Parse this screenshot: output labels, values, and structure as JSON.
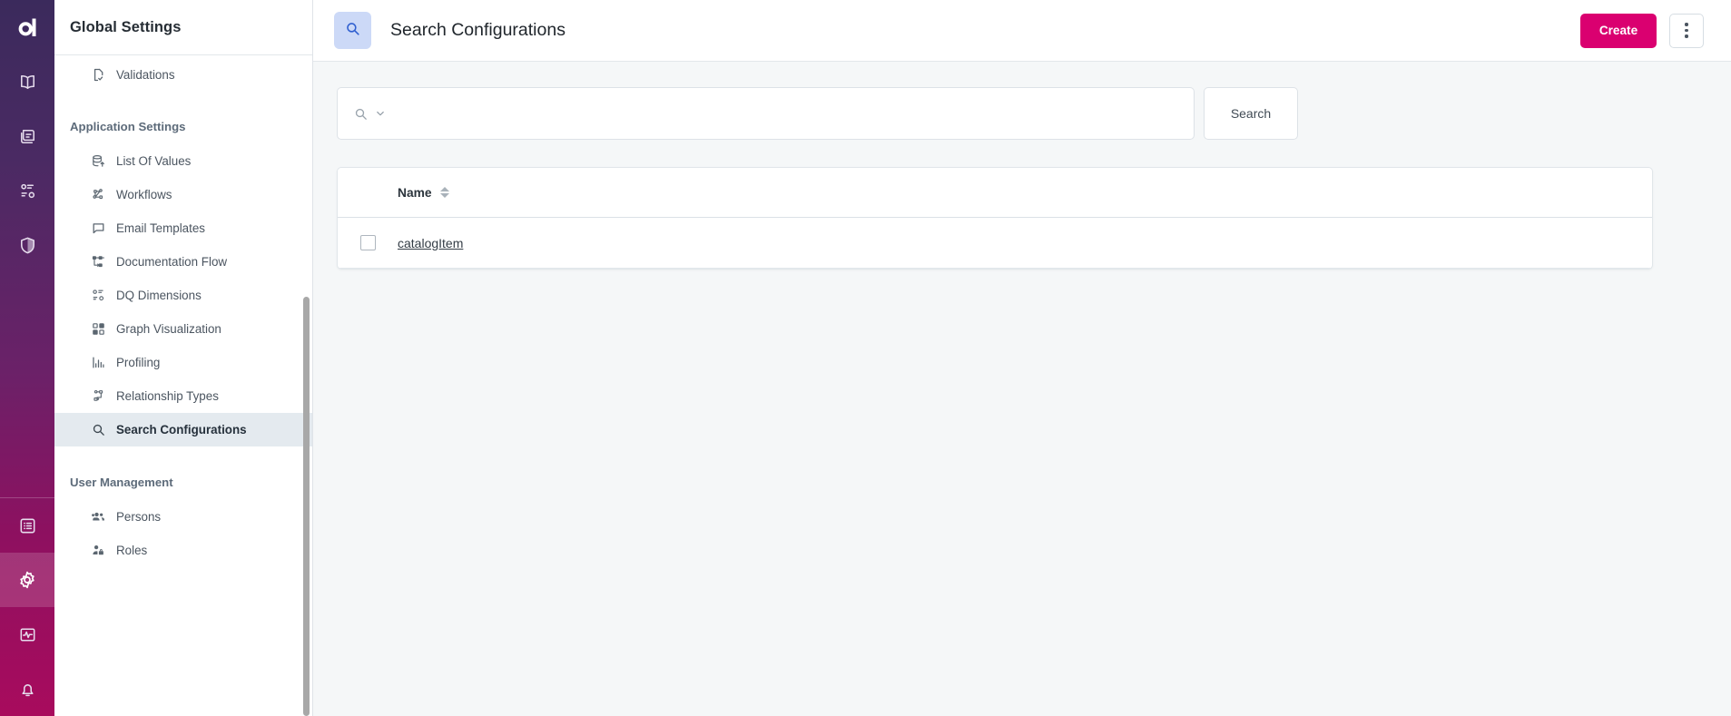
{
  "rail": {
    "logo_alt": "aplication-logo",
    "items": [
      {
        "name": "book-icon",
        "label": "Glossary",
        "active": false
      },
      {
        "name": "catalog-icon",
        "label": "Catalog",
        "active": false
      },
      {
        "name": "data-quality-icon",
        "label": "Data Quality",
        "active": false
      },
      {
        "name": "shield-icon",
        "label": "Governance",
        "active": false
      },
      {
        "name": "list-icon",
        "label": "Tasks",
        "active": false
      },
      {
        "name": "gear-icon",
        "label": "Settings",
        "active": true
      },
      {
        "name": "monitoring-icon",
        "label": "Monitoring",
        "active": false
      },
      {
        "name": "bell-icon",
        "label": "Notifications",
        "active": false
      }
    ]
  },
  "navpanel": {
    "title": "Global Settings",
    "partial_top_item": {
      "label": "Validations",
      "icon": "document-check-icon"
    },
    "groups": [
      {
        "label": "Application Settings",
        "items": [
          {
            "label": "List Of Values",
            "icon": "database-up-icon",
            "selected": false
          },
          {
            "label": "Workflows",
            "icon": "workflow-icon",
            "selected": false
          },
          {
            "label": "Email Templates",
            "icon": "speech-bubble-icon",
            "selected": false
          },
          {
            "label": "Documentation Flow",
            "icon": "flow-diagram-icon",
            "selected": false
          },
          {
            "label": "DQ Dimensions",
            "icon": "dq-dimensions-icon",
            "selected": false
          },
          {
            "label": "Graph Visualization",
            "icon": "grid-squares-icon",
            "selected": false
          },
          {
            "label": "Profiling",
            "icon": "bar-chart-icon",
            "selected": false
          },
          {
            "label": "Relationship Types",
            "icon": "relationship-icon",
            "selected": false
          },
          {
            "label": "Search Configurations",
            "icon": "search-icon",
            "selected": true
          }
        ]
      },
      {
        "label": "User Management",
        "items": [
          {
            "label": "Persons",
            "icon": "people-icon",
            "selected": false
          },
          {
            "label": "Roles",
            "icon": "person-lock-icon",
            "selected": false
          }
        ]
      }
    ]
  },
  "topbar": {
    "icon": "search-icon",
    "title": "Search Configurations",
    "create_label": "Create",
    "kebab_name": "more-options-icon"
  },
  "search": {
    "icon": "search-icon",
    "chevron": "chevron-down-icon",
    "value": "",
    "placeholder": "",
    "button_label": "Search"
  },
  "table": {
    "columns": [
      {
        "key": "checkbox",
        "label": ""
      },
      {
        "key": "name",
        "label": "Name",
        "sortable": true,
        "sort_icon": "sort-icon"
      }
    ],
    "rows": [
      {
        "checked": false,
        "name": "catalogItem"
      }
    ]
  },
  "colors": {
    "brand_pink": "#da0070",
    "rail_gradient_start": "#3b2a5c",
    "rail_gradient_end": "#a80b5d",
    "badge_bg": "#ccd9f7",
    "badge_icon": "#2f5fd0",
    "selected_nav_bg": "#e4eaef",
    "content_bg": "#f5f7f8"
  }
}
